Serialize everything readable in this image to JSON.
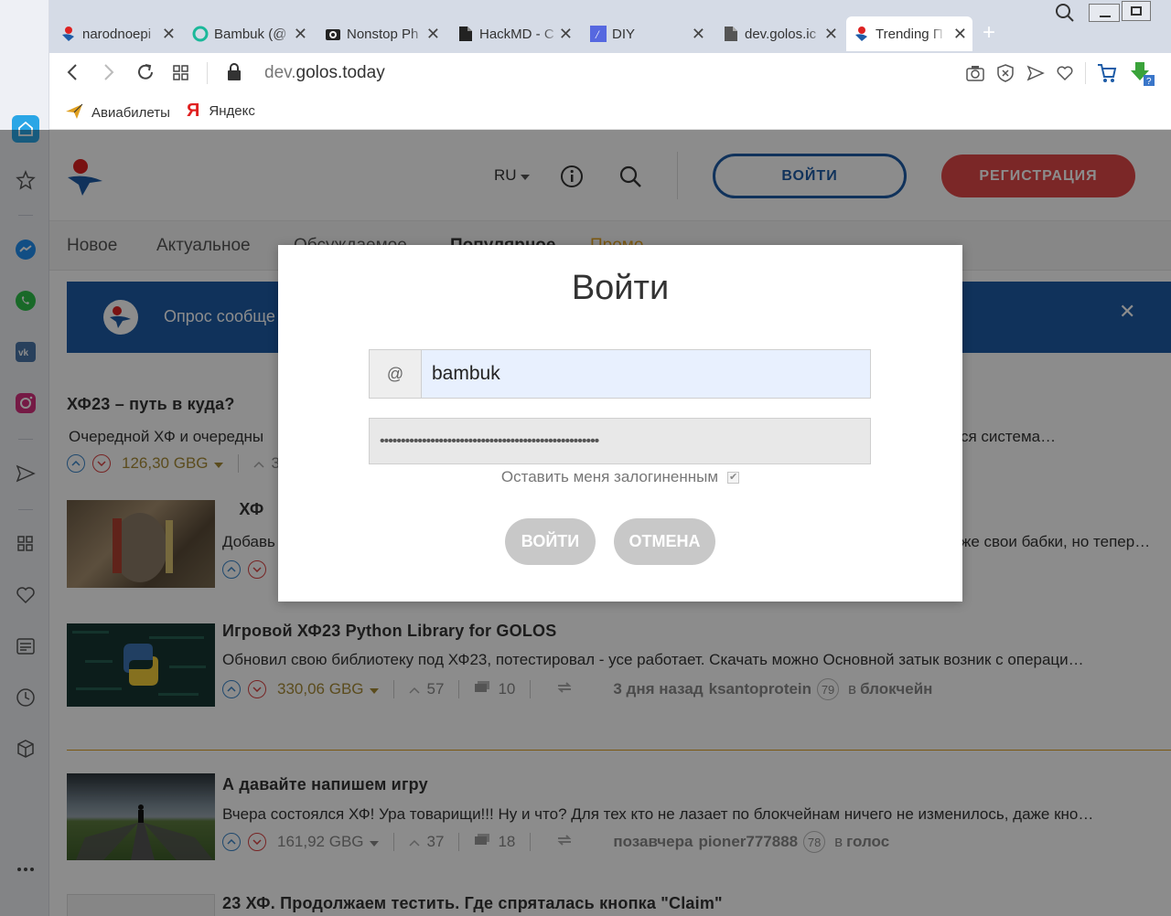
{
  "browser": {
    "tabs": [
      {
        "title": "narodnoepi",
        "icon": "golos-favicon"
      },
      {
        "title": "Bambuk (@",
        "icon": "green-circle-favicon"
      },
      {
        "title": "Nonstop Ph",
        "icon": "camera-favicon"
      },
      {
        "title": "HackMD - C",
        "icon": "document-favicon"
      },
      {
        "title": "DIY",
        "icon": "diy-favicon"
      },
      {
        "title": "dev.golos.ic",
        "icon": "document-favicon"
      },
      {
        "title": "Trending П",
        "icon": "golos-favicon",
        "active": true
      }
    ],
    "close_glyph": "✕",
    "new_tab_glyph": "+",
    "address": "dev.golos.today",
    "address_domain": "golos.today",
    "address_prefix": "dev.",
    "bookmarks": [
      {
        "label": "Авиабилеты",
        "icon": "plane-icon"
      },
      {
        "label": "Яндекс",
        "icon": "yandex-icon"
      }
    ]
  },
  "site": {
    "lang": "RU",
    "login_button": "ВОЙТИ",
    "register_button": "РЕГИСТРАЦИЯ",
    "nav": [
      "Новое",
      "Актуальное",
      "Обсуждаемое",
      "Популярное",
      "Промо"
    ],
    "banner_text": "Опрос сообще",
    "banner_close": "✕",
    "posts": [
      {
        "title": "ХФ23 – путь в куда?",
        "excerpt": "Очередной ХФ и очередны",
        "excerpt_tail": "ся система…",
        "payout": "126,30 GBG",
        "votes": "3"
      },
      {
        "title": "  ХФ",
        "excerpt": "Добавь",
        "excerpt_tail": "же свои бабки, но тепер…"
      },
      {
        "title": "Игровой ХФ23 Python Library for GOLOS",
        "excerpt": "Обновил свою библиотеку под ХФ23, потестировал - усе работает. Скачать можно Основной затык возник с операци…",
        "payout": "330,06 GBG",
        "votes": "57",
        "comments": "10",
        "time": "3 дня назад",
        "author": "ksantoprotein",
        "rep": "79",
        "in_label": "в",
        "category": "блокчейн"
      },
      {
        "title": "А давайте напишем игру",
        "excerpt": "Вчера состоялся ХФ! Ура товарищи!!! Ну и что? Для тех кто не лазает по блокчейнам ничего не изменилось, даже кно…",
        "payout": "161,92 GBG",
        "votes": "37",
        "comments": "18",
        "time": "позавчера",
        "author": "pioner777888",
        "rep": "78",
        "in_label": "в",
        "category": "голос"
      },
      {
        "title": "23 ХФ. Продолжаем тестить. Где спряталась кнопка \"Claim\""
      }
    ]
  },
  "modal": {
    "title": "Войти",
    "at_symbol": "@",
    "login_value": "bambuk",
    "password_value": "••••••••••••••••••••••••••••••••••••••••••••••••••••",
    "remember_label": "Оставить меня залогиненным",
    "remember_checked": true,
    "check_glyph": "✔",
    "submit_label": "ВОЙТИ",
    "cancel_label": "ОТМЕНА"
  },
  "colors": {
    "opera_red": "#e0201f",
    "golos_blue": "#1e5ca7",
    "register_red": "#e04848",
    "vote_up": "#3b86c9",
    "vote_down": "#d94343",
    "payout": "#a78a36",
    "promo": "#e0a020"
  }
}
